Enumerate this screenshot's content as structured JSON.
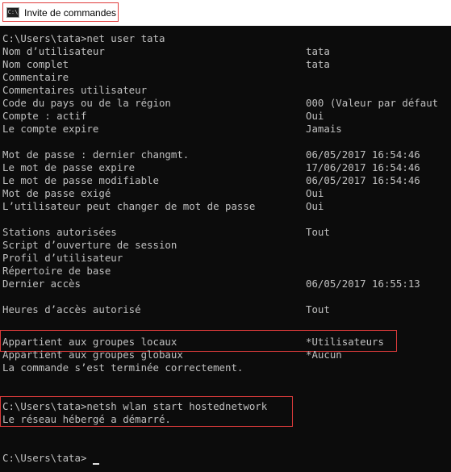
{
  "window": {
    "title": "Invite de commandes",
    "icon": "cmd-icon",
    "icon_glyph": "C:\\"
  },
  "console": {
    "lines": [
      {
        "text": "C:\\Users\\tata>net user tata",
        "value": ""
      },
      {
        "text": "Nom d’utilisateur",
        "value": "tata"
      },
      {
        "text": "Nom complet",
        "value": "tata"
      },
      {
        "text": "Commentaire",
        "value": ""
      },
      {
        "text": "Commentaires utilisateur",
        "value": ""
      },
      {
        "text": "Code du pays ou de la région",
        "value": "000 (Valeur par défaut"
      },
      {
        "text": "Compte : actif",
        "value": "Oui"
      },
      {
        "text": "Le compte expire",
        "value": "Jamais"
      },
      {
        "text": "",
        "value": ""
      },
      {
        "text": "Mot de passe : dernier changmt.",
        "value": "06/05/2017 16:54:46"
      },
      {
        "text": "Le mot de passe expire",
        "value": "17/06/2017 16:54:46"
      },
      {
        "text": "Le mot de passe modifiable",
        "value": "06/05/2017 16:54:46"
      },
      {
        "text": "Mot de passe exigé",
        "value": "Oui"
      },
      {
        "text": "L’utilisateur peut changer de mot de passe",
        "value": "Oui"
      },
      {
        "text": "",
        "value": ""
      },
      {
        "text": "Stations autorisées",
        "value": "Tout"
      },
      {
        "text": "Script d’ouverture de session",
        "value": ""
      },
      {
        "text": "Profil d’utilisateur",
        "value": ""
      },
      {
        "text": "Répertoire de base",
        "value": ""
      },
      {
        "text": "Dernier accès",
        "value": "06/05/2017 16:55:13"
      },
      {
        "text": "",
        "value": ""
      },
      {
        "text": "Heures d’accès autorisé",
        "value": "Tout"
      },
      {
        "text": "",
        "value": ""
      },
      {
        "text": "Appartient aux groupes locaux",
        "value": "*Utilisateurs"
      },
      {
        "text": "Appartient aux groupes globaux",
        "value": "*Aucun"
      },
      {
        "text": "La commande s’est terminée correctement.",
        "value": ""
      },
      {
        "text": "",
        "value": ""
      },
      {
        "text": "",
        "value": ""
      },
      {
        "text": "C:\\Users\\tata>netsh wlan start hostednetwork",
        "value": ""
      },
      {
        "text": "Le réseau hébergé a démarré.",
        "value": ""
      },
      {
        "text": "",
        "value": ""
      },
      {
        "text": "",
        "value": ""
      },
      {
        "text": "C:\\Users\\tata>",
        "value": ""
      }
    ]
  },
  "colors": {
    "console_bg": "#0c0c0c",
    "console_text": "#c0c0c0",
    "highlight": "#d83a3a"
  }
}
